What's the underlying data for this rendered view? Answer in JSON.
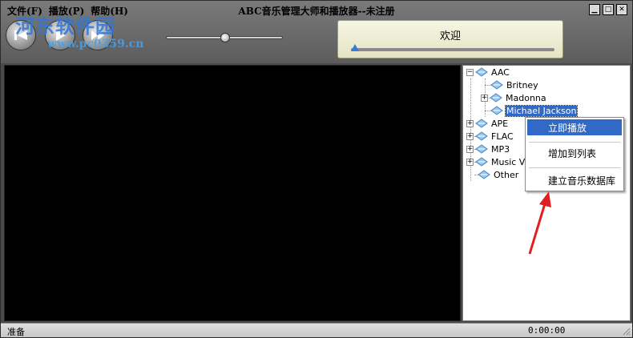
{
  "window": {
    "title": "ABC音乐管理大师和播放器--未注册",
    "controls": {
      "minimize": "▁",
      "maximize": "□",
      "close": "✕"
    }
  },
  "menu": {
    "items": [
      "文件(F)",
      "播放(P)",
      "帮助(H)"
    ]
  },
  "watermark": {
    "text": "河东软件园",
    "url": "www.pc0359.cn"
  },
  "player": {
    "buttons": [
      {
        "name": "previous",
        "icon": "previous-icon"
      },
      {
        "name": "play",
        "icon": "play-icon"
      },
      {
        "name": "next",
        "icon": "fast-forward-icon"
      }
    ],
    "volume_fraction": 0.5,
    "display_text": "欢迎",
    "progress_fraction": 0.0
  },
  "tree": {
    "nodes": [
      {
        "label": "AAC",
        "level": 0,
        "expander": "⊟",
        "expanded": true
      },
      {
        "label": "Britney",
        "level": 1,
        "expander": ""
      },
      {
        "label": "Madonna",
        "level": 1,
        "expander": "⊞"
      },
      {
        "label": "Michael Jackson",
        "level": 1,
        "expander": "",
        "selected": true
      },
      {
        "label": "APE",
        "level": 0,
        "expander": "⊞"
      },
      {
        "label": "FLAC",
        "level": 0,
        "expander": "⊞"
      },
      {
        "label": "MP3",
        "level": 0,
        "expander": "⊞"
      },
      {
        "label": "Music V",
        "level": 0,
        "expander": "⊞"
      },
      {
        "label": "Other",
        "level": 0,
        "expander": ""
      }
    ]
  },
  "context_menu": {
    "items": [
      "立即播放",
      "增加到列表",
      "建立音乐数据库"
    ]
  },
  "status": {
    "text": "准备",
    "time": "0:00:00"
  },
  "colors": {
    "selection": "#3169c6",
    "annotation_arrow": "#e02020",
    "watermark": "#2e78d9"
  }
}
